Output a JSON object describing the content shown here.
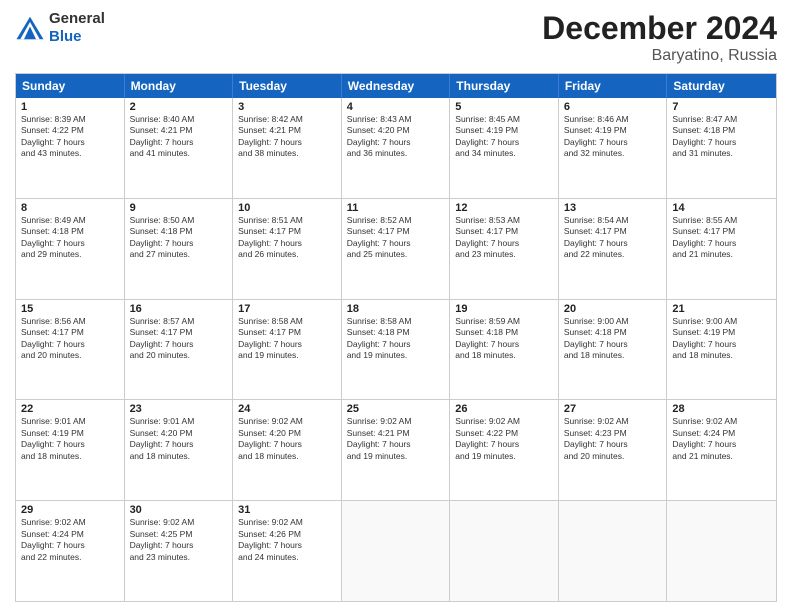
{
  "header": {
    "logo_general": "General",
    "logo_blue": "Blue",
    "month_title": "December 2024",
    "location": "Baryatino, Russia"
  },
  "days_of_week": [
    "Sunday",
    "Monday",
    "Tuesday",
    "Wednesday",
    "Thursday",
    "Friday",
    "Saturday"
  ],
  "weeks": [
    [
      {
        "day": "1",
        "lines": [
          "Sunrise: 8:39 AM",
          "Sunset: 4:22 PM",
          "Daylight: 7 hours",
          "and 43 minutes."
        ]
      },
      {
        "day": "2",
        "lines": [
          "Sunrise: 8:40 AM",
          "Sunset: 4:21 PM",
          "Daylight: 7 hours",
          "and 41 minutes."
        ]
      },
      {
        "day": "3",
        "lines": [
          "Sunrise: 8:42 AM",
          "Sunset: 4:21 PM",
          "Daylight: 7 hours",
          "and 38 minutes."
        ]
      },
      {
        "day": "4",
        "lines": [
          "Sunrise: 8:43 AM",
          "Sunset: 4:20 PM",
          "Daylight: 7 hours",
          "and 36 minutes."
        ]
      },
      {
        "day": "5",
        "lines": [
          "Sunrise: 8:45 AM",
          "Sunset: 4:19 PM",
          "Daylight: 7 hours",
          "and 34 minutes."
        ]
      },
      {
        "day": "6",
        "lines": [
          "Sunrise: 8:46 AM",
          "Sunset: 4:19 PM",
          "Daylight: 7 hours",
          "and 32 minutes."
        ]
      },
      {
        "day": "7",
        "lines": [
          "Sunrise: 8:47 AM",
          "Sunset: 4:18 PM",
          "Daylight: 7 hours",
          "and 31 minutes."
        ]
      }
    ],
    [
      {
        "day": "8",
        "lines": [
          "Sunrise: 8:49 AM",
          "Sunset: 4:18 PM",
          "Daylight: 7 hours",
          "and 29 minutes."
        ]
      },
      {
        "day": "9",
        "lines": [
          "Sunrise: 8:50 AM",
          "Sunset: 4:18 PM",
          "Daylight: 7 hours",
          "and 27 minutes."
        ]
      },
      {
        "day": "10",
        "lines": [
          "Sunrise: 8:51 AM",
          "Sunset: 4:17 PM",
          "Daylight: 7 hours",
          "and 26 minutes."
        ]
      },
      {
        "day": "11",
        "lines": [
          "Sunrise: 8:52 AM",
          "Sunset: 4:17 PM",
          "Daylight: 7 hours",
          "and 25 minutes."
        ]
      },
      {
        "day": "12",
        "lines": [
          "Sunrise: 8:53 AM",
          "Sunset: 4:17 PM",
          "Daylight: 7 hours",
          "and 23 minutes."
        ]
      },
      {
        "day": "13",
        "lines": [
          "Sunrise: 8:54 AM",
          "Sunset: 4:17 PM",
          "Daylight: 7 hours",
          "and 22 minutes."
        ]
      },
      {
        "day": "14",
        "lines": [
          "Sunrise: 8:55 AM",
          "Sunset: 4:17 PM",
          "Daylight: 7 hours",
          "and 21 minutes."
        ]
      }
    ],
    [
      {
        "day": "15",
        "lines": [
          "Sunrise: 8:56 AM",
          "Sunset: 4:17 PM",
          "Daylight: 7 hours",
          "and 20 minutes."
        ]
      },
      {
        "day": "16",
        "lines": [
          "Sunrise: 8:57 AM",
          "Sunset: 4:17 PM",
          "Daylight: 7 hours",
          "and 20 minutes."
        ]
      },
      {
        "day": "17",
        "lines": [
          "Sunrise: 8:58 AM",
          "Sunset: 4:17 PM",
          "Daylight: 7 hours",
          "and 19 minutes."
        ]
      },
      {
        "day": "18",
        "lines": [
          "Sunrise: 8:58 AM",
          "Sunset: 4:18 PM",
          "Daylight: 7 hours",
          "and 19 minutes."
        ]
      },
      {
        "day": "19",
        "lines": [
          "Sunrise: 8:59 AM",
          "Sunset: 4:18 PM",
          "Daylight: 7 hours",
          "and 18 minutes."
        ]
      },
      {
        "day": "20",
        "lines": [
          "Sunrise: 9:00 AM",
          "Sunset: 4:18 PM",
          "Daylight: 7 hours",
          "and 18 minutes."
        ]
      },
      {
        "day": "21",
        "lines": [
          "Sunrise: 9:00 AM",
          "Sunset: 4:19 PM",
          "Daylight: 7 hours",
          "and 18 minutes."
        ]
      }
    ],
    [
      {
        "day": "22",
        "lines": [
          "Sunrise: 9:01 AM",
          "Sunset: 4:19 PM",
          "Daylight: 7 hours",
          "and 18 minutes."
        ]
      },
      {
        "day": "23",
        "lines": [
          "Sunrise: 9:01 AM",
          "Sunset: 4:20 PM",
          "Daylight: 7 hours",
          "and 18 minutes."
        ]
      },
      {
        "day": "24",
        "lines": [
          "Sunrise: 9:02 AM",
          "Sunset: 4:20 PM",
          "Daylight: 7 hours",
          "and 18 minutes."
        ]
      },
      {
        "day": "25",
        "lines": [
          "Sunrise: 9:02 AM",
          "Sunset: 4:21 PM",
          "Daylight: 7 hours",
          "and 19 minutes."
        ]
      },
      {
        "day": "26",
        "lines": [
          "Sunrise: 9:02 AM",
          "Sunset: 4:22 PM",
          "Daylight: 7 hours",
          "and 19 minutes."
        ]
      },
      {
        "day": "27",
        "lines": [
          "Sunrise: 9:02 AM",
          "Sunset: 4:23 PM",
          "Daylight: 7 hours",
          "and 20 minutes."
        ]
      },
      {
        "day": "28",
        "lines": [
          "Sunrise: 9:02 AM",
          "Sunset: 4:24 PM",
          "Daylight: 7 hours",
          "and 21 minutes."
        ]
      }
    ],
    [
      {
        "day": "29",
        "lines": [
          "Sunrise: 9:02 AM",
          "Sunset: 4:24 PM",
          "Daylight: 7 hours",
          "and 22 minutes."
        ]
      },
      {
        "day": "30",
        "lines": [
          "Sunrise: 9:02 AM",
          "Sunset: 4:25 PM",
          "Daylight: 7 hours",
          "and 23 minutes."
        ]
      },
      {
        "day": "31",
        "lines": [
          "Sunrise: 9:02 AM",
          "Sunset: 4:26 PM",
          "Daylight: 7 hours",
          "and 24 minutes."
        ]
      },
      {
        "day": "",
        "lines": []
      },
      {
        "day": "",
        "lines": []
      },
      {
        "day": "",
        "lines": []
      },
      {
        "day": "",
        "lines": []
      }
    ]
  ]
}
